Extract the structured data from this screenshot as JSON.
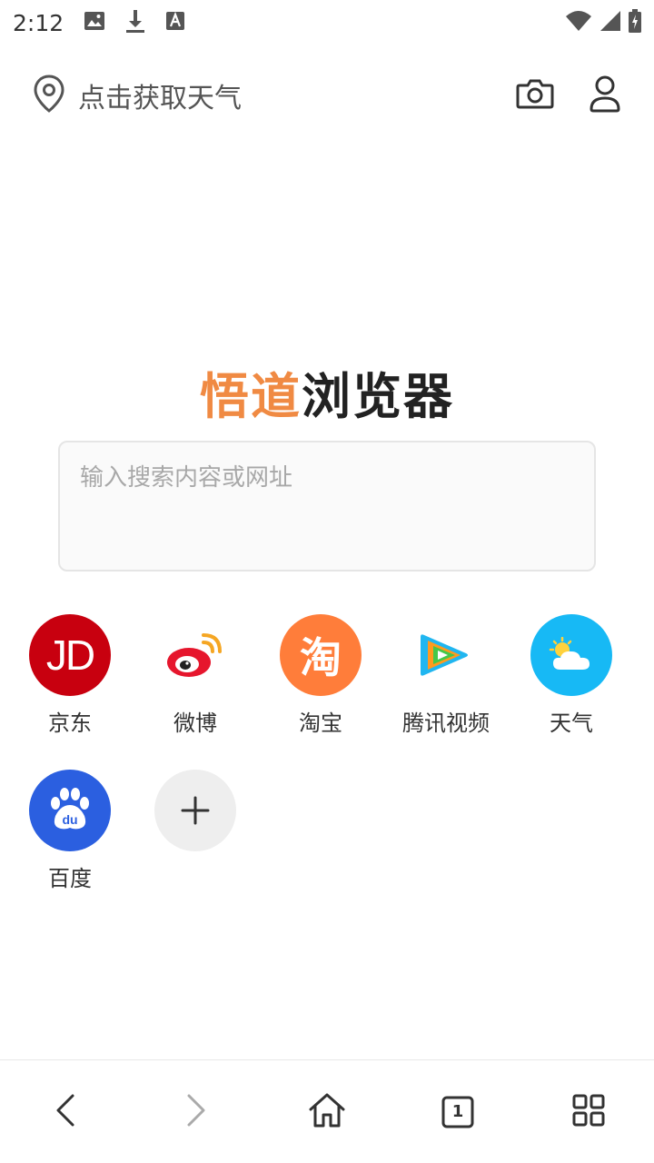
{
  "status_bar": {
    "time": "2:12",
    "icons_left": [
      "image-icon",
      "download-icon",
      "font-icon"
    ],
    "icons_right": [
      "wifi-icon",
      "signal-icon",
      "battery-icon"
    ]
  },
  "top_bar": {
    "weather_label": "点击获取天气",
    "location_icon": "location-pin-icon",
    "camera_icon": "camera-icon",
    "profile_icon": "user-icon"
  },
  "logo": {
    "accent_text": "悟道",
    "main_text": "浏览器",
    "accent_color": "#f08a43"
  },
  "search": {
    "placeholder": "输入搜索内容或网址",
    "value": ""
  },
  "shortcuts": [
    {
      "label": "京东",
      "icon": "jd-icon",
      "color": "#c8000f"
    },
    {
      "label": "微博",
      "icon": "weibo-icon",
      "color": "#ffffff"
    },
    {
      "label": "淘宝",
      "icon": "taobao-icon",
      "color": "#ff7d3a"
    },
    {
      "label": "腾讯视频",
      "icon": "tencent-video-icon",
      "color": "#ffffff"
    },
    {
      "label": "天气",
      "icon": "weather-icon",
      "color": "#17b9f5"
    },
    {
      "label": "百度",
      "icon": "baidu-icon",
      "color": "#2b5fe0"
    },
    {
      "label": "",
      "icon": "add-icon",
      "color": "#eeeeee"
    }
  ],
  "shortcut_glyphs": {
    "jd": "JD",
    "taobao": "淘",
    "baidu": "du"
  },
  "bottom_nav": {
    "tab_count": "1",
    "items": [
      "back-icon",
      "forward-icon",
      "home-icon",
      "tabs-icon",
      "menu-grid-icon"
    ]
  }
}
